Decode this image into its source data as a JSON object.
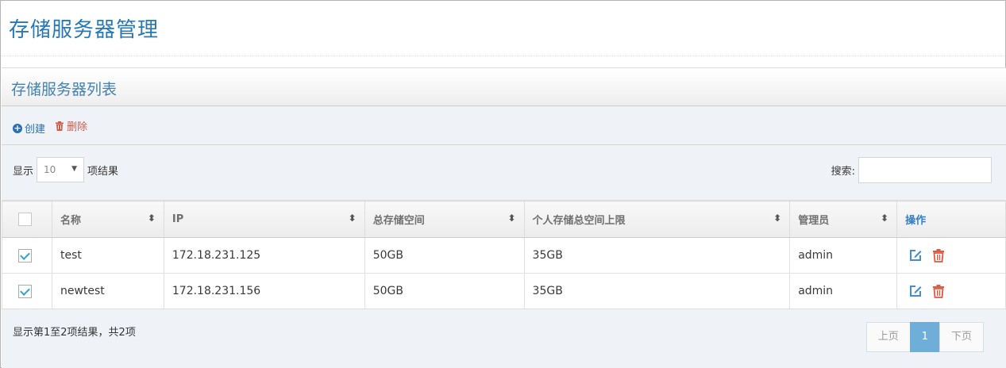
{
  "page": {
    "title": "存储服务器管理"
  },
  "widget": {
    "title": "存储服务器列表"
  },
  "toolbar": {
    "create_label": "创建",
    "delete_label": "删除"
  },
  "length": {
    "prefix": "显示",
    "value": "10",
    "suffix": "项结果"
  },
  "search": {
    "label": "搜索:",
    "value": ""
  },
  "table": {
    "headers": [
      "名称",
      "IP",
      "总存储空间",
      "个人存储总空间上限",
      "管理员",
      "操作"
    ],
    "rows": [
      {
        "checked": true,
        "name": "test",
        "ip": "172.18.231.125",
        "total": "50GB",
        "limit": "35GB",
        "admin": "admin"
      },
      {
        "checked": true,
        "name": "newtest",
        "ip": "172.18.231.156",
        "total": "50GB",
        "limit": "35GB",
        "admin": "admin"
      }
    ]
  },
  "footer": {
    "info": "显示第1至2项结果，共2项",
    "prev_label": "上页",
    "current_page": "1",
    "next_label": "下页"
  },
  "colors": {
    "accent": "#2679b5",
    "delete": "#d15b47",
    "active_page": "#6faed9",
    "check": "#32a3ce"
  },
  "icons": {
    "create": "plus-circle-icon",
    "delete": "trash-icon",
    "edit": "edit-icon",
    "sort": "sort-icon",
    "dropdown": "caret-down-icon"
  }
}
